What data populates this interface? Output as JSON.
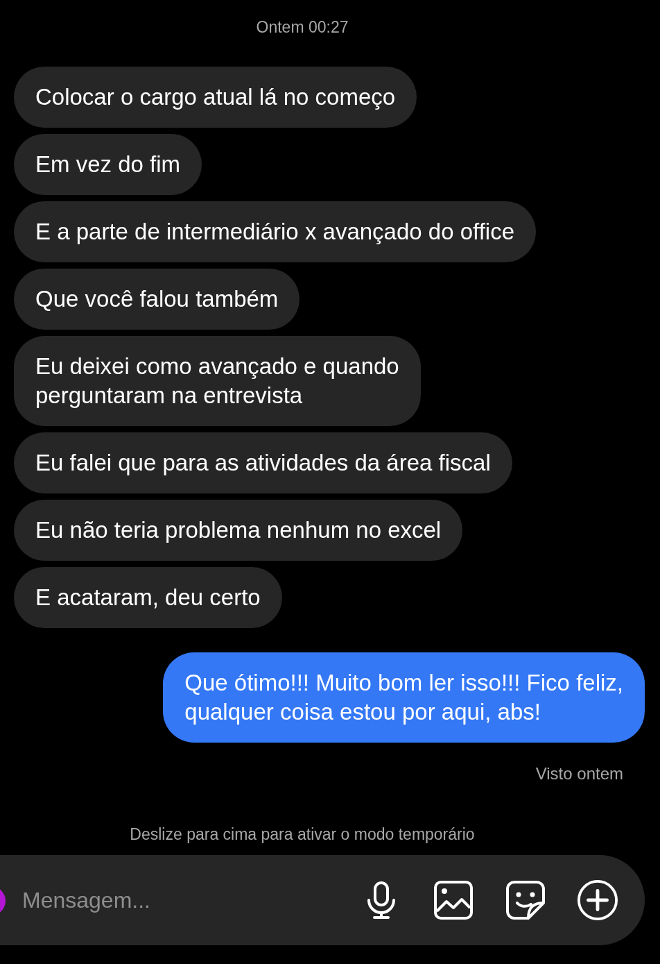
{
  "timestamp": "Ontem 00:27",
  "messages": [
    {
      "kind": "received",
      "text": "Colocar o cargo atual lá no começo"
    },
    {
      "kind": "received",
      "text": "Em vez do fim"
    },
    {
      "kind": "received",
      "text": "E a parte de intermediário x avançado do office"
    },
    {
      "kind": "received",
      "text": "Que você falou também"
    },
    {
      "kind": "received",
      "text": "Eu deixei como avançado e quando\nperguntaram na entrevista"
    },
    {
      "kind": "received",
      "text": "Eu falei que para as atividades da área fiscal"
    },
    {
      "kind": "received",
      "text": "Eu não teria problema nenhum no excel"
    },
    {
      "kind": "received",
      "text": "E acataram, deu certo"
    },
    {
      "kind": "sent",
      "text": "Que ótimo!!! Muito bom ler isso!!! Fico feliz,\nqualquer coisa estou por aqui, abs!"
    }
  ],
  "seen_status": "Visto ontem",
  "hint": "Deslize para cima para ativar o modo temporário",
  "composer": {
    "placeholder": "Mensagem..."
  }
}
